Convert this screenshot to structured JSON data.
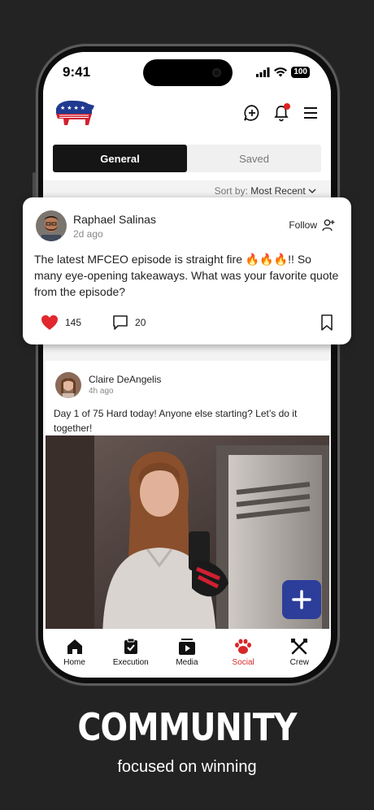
{
  "status_bar": {
    "time": "9:41",
    "battery": "100"
  },
  "tabs": {
    "general": "General",
    "saved": "Saved"
  },
  "sort": {
    "label": "Sort by:",
    "value": "Most Recent"
  },
  "featured_post": {
    "author": "Raphael Salinas",
    "time_ago": "2d ago",
    "follow_label": "Follow",
    "text": "The latest MFCEO episode is straight fire 🔥🔥🔥!! So many eye-opening takeaways. What was your favorite quote from the episode?",
    "likes": "145",
    "comments": "20"
  },
  "second_post": {
    "author": "Claire DeAngelis",
    "time_ago": "4h ago",
    "text": "Day 1 of 75 Hard today! Anyone else starting? Let’s do it together!"
  },
  "nav": [
    {
      "label": "Home",
      "icon": "home-icon"
    },
    {
      "label": "Execution",
      "icon": "clipboard-check-icon"
    },
    {
      "label": "Media",
      "icon": "play-icon"
    },
    {
      "label": "Social",
      "icon": "paw-icon"
    },
    {
      "label": "Crew",
      "icon": "crossed-tools-icon"
    }
  ],
  "accent_colors": {
    "social_active": "#d62828",
    "fab": "#2c3e9a",
    "like": "#e0282e"
  },
  "marketing": {
    "headline": "COMMUNITY",
    "subline": "focused on winning"
  }
}
